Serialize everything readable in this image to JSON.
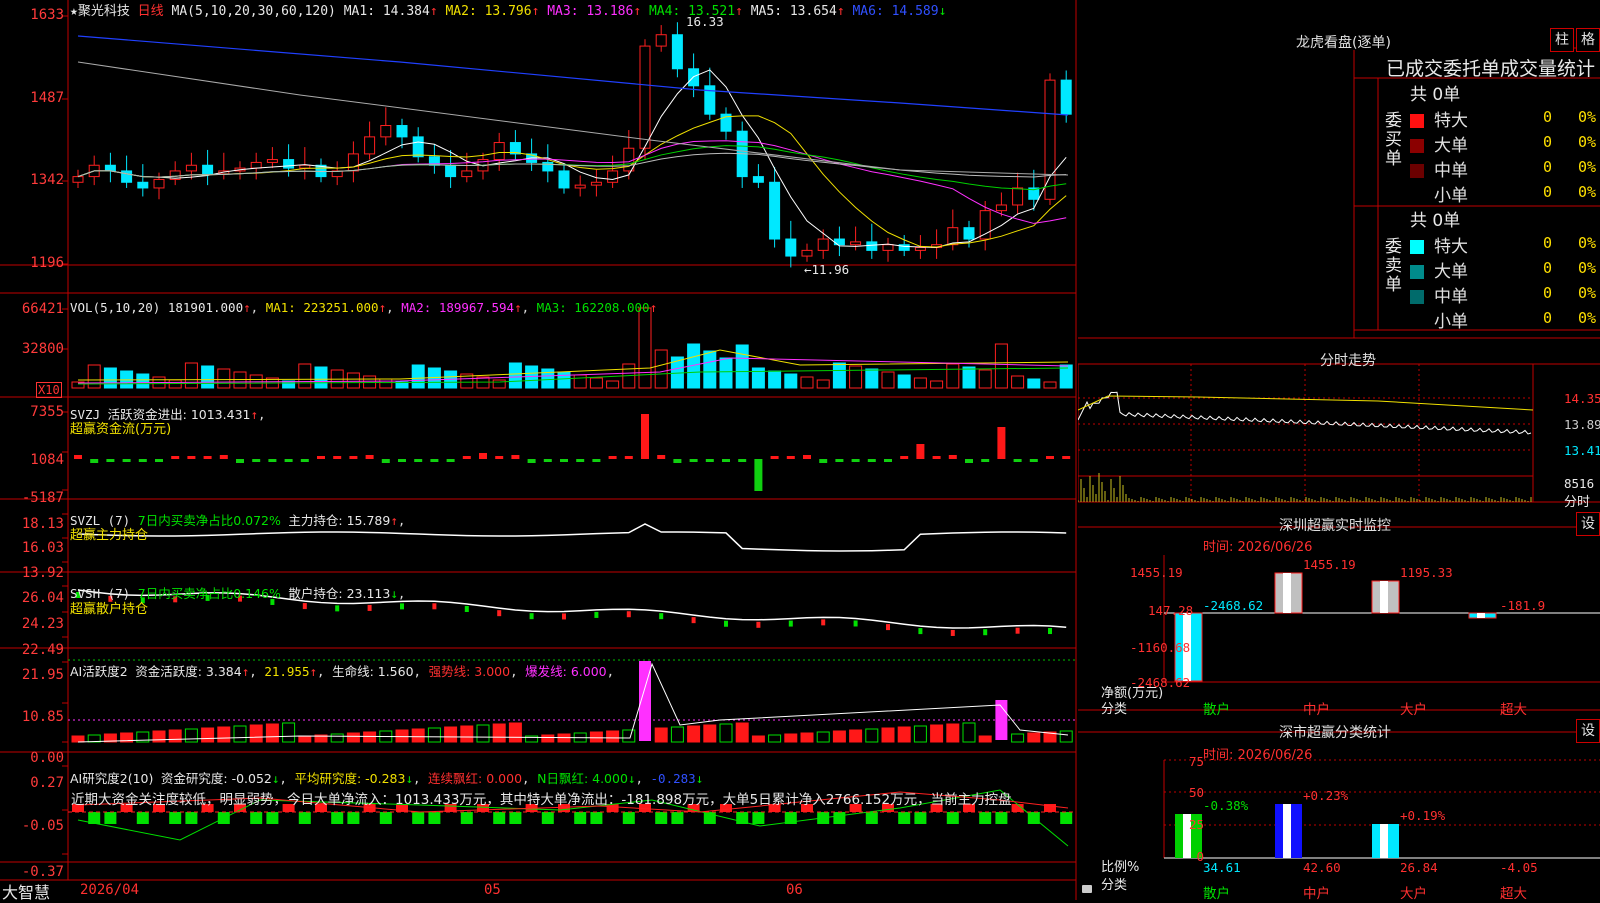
{
  "stock": {
    "name": "聚光科技",
    "star": "★",
    "period": "日线"
  },
  "price_axis": [
    "1633",
    "1487",
    "1342",
    "1196"
  ],
  "ma_line": {
    "label": "MA(5,10,20,30,60,120)",
    "ma1": "MA1: 14.384",
    "ma2": "MA2: 13.796",
    "ma3": "MA3: 13.186",
    "ma4": "MA4: 13.521",
    "ma5": "MA5: 13.654",
    "ma6": "MA6: 14.589",
    "up": "↑",
    "down": "↓"
  },
  "price_marks": {
    "high": "16.33",
    "low": "←11.96"
  },
  "vol": {
    "label": "VOL(5,10,20)",
    "val": "181901.000",
    "ma1": "MA1: 223251.000",
    "ma2": "MA2: 189967.594",
    "ma3": "MA3: 162208.000",
    "axis": [
      "66421",
      "32800"
    ],
    "unit": "X10"
  },
  "svzj": {
    "label": "SVZJ",
    "title": "活跃资金进出: 1013.431",
    "sub": "超赢资金流(万元)",
    "axis": [
      "7355",
      "1084",
      "-5187"
    ]
  },
  "svzl": {
    "label": "SVZL (7)",
    "t1": "7日内买卖净占比0.072%",
    "t2": "主力持仓: 15.789",
    "sub": "超赢主力持仓",
    "axis": [
      "18.13",
      "16.03",
      "13.92"
    ]
  },
  "svsh": {
    "label": "SVSH (7)",
    "t1": "7日内买卖净占比0.146%",
    "t2": "散户持仓: 23.113",
    "sub": "超赢散户持仓",
    "axis": [
      "26.04",
      "24.23",
      "22.49"
    ]
  },
  "ai1": {
    "label": "AI活跃度2",
    "t1": "资金活跃度: 3.384",
    "t2": "21.955",
    "t3": "生命线: 1.560",
    "t4": "强势线: 3.000",
    "t5": "爆发线: 6.000",
    "axis": [
      "21.95",
      "10.85",
      "0.00"
    ]
  },
  "ai2": {
    "label": "AI研究度2(10)",
    "t1": "资金研究度: -0.052",
    "t2": "平均研究度: -0.283",
    "t3": "连续飘红: 0.000",
    "t4": "N日飘红: 4.000",
    "t5": "-0.283",
    "axis": [
      "0.27",
      "-0.05",
      "-0.37"
    ],
    "comment": "近期大资金关注度较低，明显弱势，今日大单净流入：1013.433万元，其中特大单净流出：-181.898万元，大单5日累计净入2766.152万元，当前主力控盘"
  },
  "dates": [
    "2026/04",
    "05",
    "06"
  ],
  "brand": "大智慧",
  "dragon": {
    "title": "龙虎看盘(逐单)",
    "btn_zhu": "柱",
    "btn_ge": "格",
    "subtitle": "已成交委托单成交量统计",
    "buy": {
      "side": "委买单",
      "total": "共 0单",
      "rows": [
        {
          "k": "特大",
          "v": "0",
          "p": "0%",
          "c": "#ff1010"
        },
        {
          "k": "大单",
          "v": "0",
          "p": "0%",
          "c": "#8b0000"
        },
        {
          "k": "中单",
          "v": "0",
          "p": "0%",
          "c": "#6b0000"
        },
        {
          "k": "小单",
          "v": "0",
          "p": "0%",
          "c": "#000"
        }
      ]
    },
    "sell": {
      "side": "委卖单",
      "total": "共 0单",
      "rows": [
        {
          "k": "特大",
          "v": "0",
          "p": "0%",
          "c": "#00ffff"
        },
        {
          "k": "大单",
          "v": "0",
          "p": "0%",
          "c": "#008b8b"
        },
        {
          "k": "中单",
          "v": "0",
          "p": "0%",
          "c": "#006b6b"
        },
        {
          "k": "小单",
          "v": "0",
          "p": "0%",
          "c": "#000"
        }
      ]
    }
  },
  "intraday": {
    "title": "分时走势",
    "axis": [
      "14.35",
      "13.89",
      "13.41"
    ],
    "vol_axis": "8516",
    "unit": "分时"
  },
  "sz_monitor": {
    "title": "深圳超赢实时监控",
    "btn": "设",
    "time": "时间: 2026/06/26",
    "axis": [
      "1455.19",
      "147.28",
      "-1160.68",
      "-2468.62"
    ],
    "ylabel": "净额(万元)",
    "xlabel": "分类",
    "cats": [
      "散户",
      "中户",
      "大户",
      "超大"
    ],
    "values": [
      "-2468.62",
      "1455.19",
      "1195.33",
      "-181.9"
    ]
  },
  "sz_stat": {
    "title": "深市超赢分类统计",
    "btn": "设",
    "time": "时间: 2026/06/26",
    "axis": [
      "75",
      "50",
      "25",
      "0"
    ],
    "ylabel": "比例%",
    "xlabel": "分类",
    "cats": [
      "散户",
      "中户",
      "大户",
      "超大"
    ],
    "values": [
      "34.61",
      "42.60",
      "26.84",
      "-4.05"
    ],
    "changes": [
      "-0.38%",
      "+0.23%",
      "+0.19%",
      ""
    ]
  }
}
